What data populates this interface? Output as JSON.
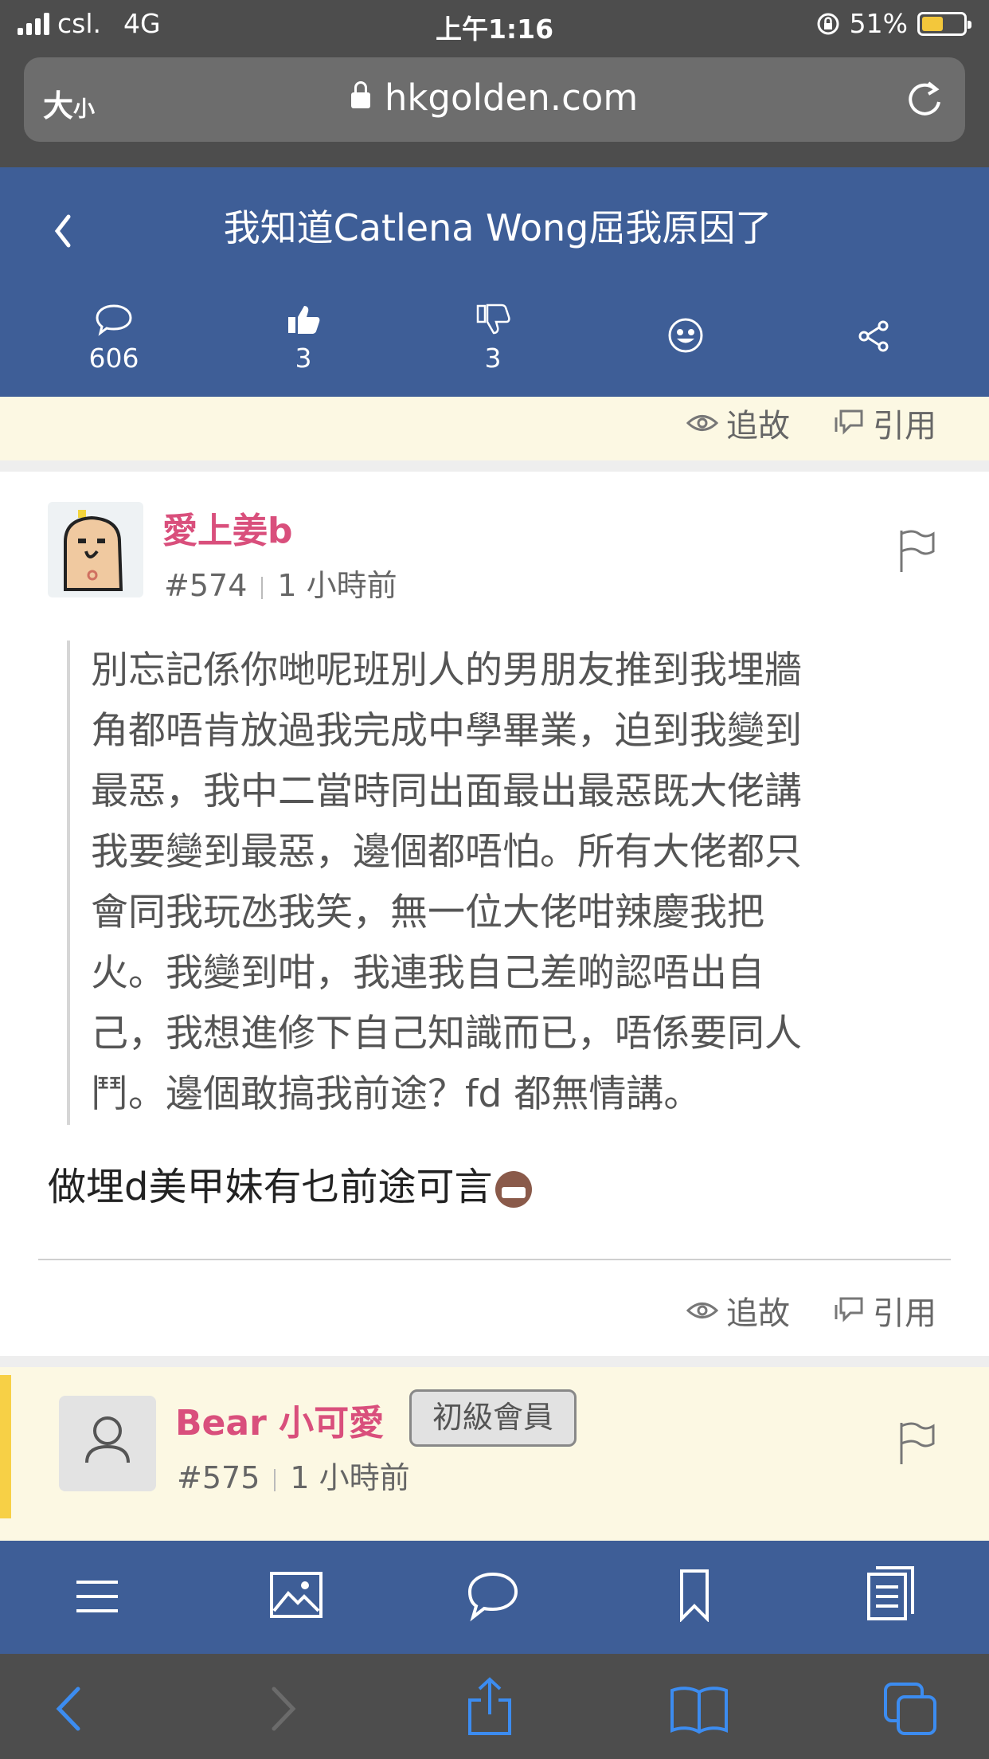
{
  "status_bar": {
    "carrier": "csl.",
    "network": "4G",
    "time": "上午1:16",
    "battery": "51%",
    "battery_level": 0.51
  },
  "address_bar": {
    "text_size_big": "大",
    "text_size_small": "小",
    "url": "hkgolden.com"
  },
  "header": {
    "title": "我知道Catlena Wong屈我原因了",
    "stats": [
      {
        "icon": "comment-icon",
        "value": "606"
      },
      {
        "icon": "thumbs-up-icon",
        "value": "3"
      },
      {
        "icon": "thumbs-down-icon",
        "value": "3"
      },
      {
        "icon": "emoji-icon",
        "value": ""
      },
      {
        "icon": "share-icon",
        "value": ""
      }
    ]
  },
  "actions": {
    "trace_label": "追故",
    "quote_label": "引用"
  },
  "post": {
    "username": "愛上姜b",
    "number": "#574",
    "time": "1 小時前",
    "quote_lines": [
      "別忘記係你哋呢班別人的男朋友推到我埋牆",
      "角都唔肯放過我完成中學畢業，迫到我變到",
      "最惡，我中二當時同出面最出最惡既大佬講",
      "我要變到最惡，邊個都唔怕。所有大佬都只",
      "會同我玩氹我笑，無一位大佬咁辣慶我把",
      "火。我變到咁，我連我自己差啲認唔出自",
      "己，我想進修下自己知識而已，唔係要同人",
      "鬥。邊個敢搞我前途？fd 都無情講。"
    ],
    "reply": "做埋d美甲妹有乜前途可言"
  },
  "next_post": {
    "username": "Bear 小可愛",
    "badge": "初級會員",
    "number": "#575",
    "time": "1 小時前"
  },
  "forum_toolbar": [
    "menu-icon",
    "image-icon",
    "chat-icon",
    "bookmark-icon",
    "pages-icon"
  ],
  "safari_toolbar": [
    "back-icon",
    "forward-icon",
    "share-icon",
    "bookmarks-icon",
    "tabs-icon"
  ],
  "colors": {
    "header_blue": "#3e5e97",
    "username_pink": "#d94f7c",
    "highlight_yellow": "#fcf8e3",
    "accent_yellow": "#f7d046",
    "safari_blue": "#3c8cf0"
  }
}
